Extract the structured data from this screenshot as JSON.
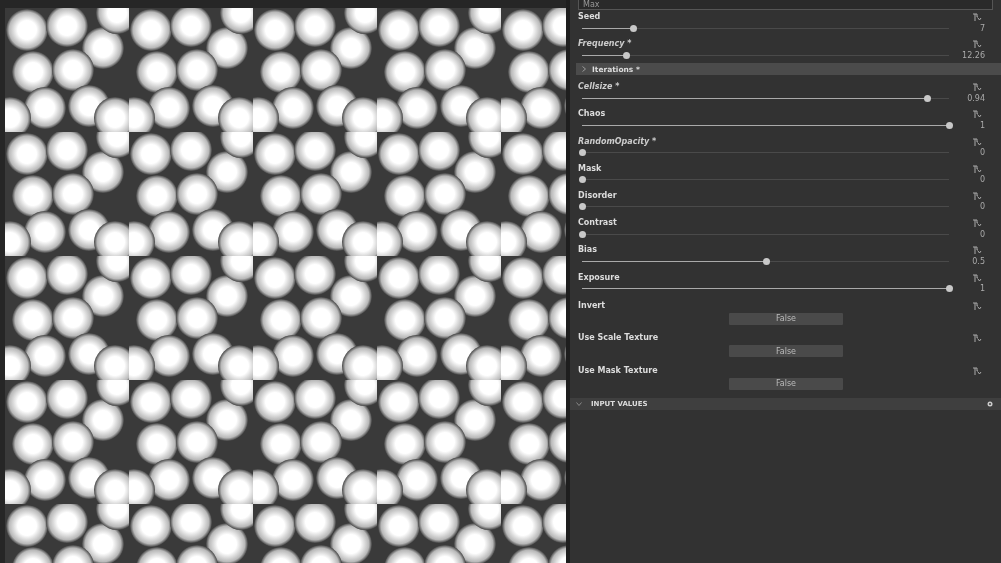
{
  "dropdown": {
    "value": "Max"
  },
  "parameters": [
    {
      "kind": "slider",
      "label": "Seed",
      "modified": false,
      "level": 0.14,
      "value": "7"
    },
    {
      "kind": "slider",
      "label": "Frequency *",
      "modified": true,
      "level": 0.12,
      "value": "12.26"
    },
    {
      "kind": "section",
      "label": "Iterations *",
      "expanded": false
    },
    {
      "kind": "slider",
      "label": "Cellsize *",
      "modified": true,
      "level": 0.94,
      "value": "0.94"
    },
    {
      "kind": "slider",
      "label": "Chaos",
      "modified": false,
      "level": 1,
      "value": "1"
    },
    {
      "kind": "slider",
      "label": "RandomOpacity *",
      "modified": true,
      "level": 0,
      "value": "0"
    },
    {
      "kind": "slider",
      "label": "Mask",
      "modified": false,
      "level": 0,
      "value": "0"
    },
    {
      "kind": "slider",
      "label": "Disorder",
      "modified": false,
      "level": 0,
      "value": "0"
    },
    {
      "kind": "slider",
      "label": "Contrast",
      "modified": false,
      "level": 0,
      "value": "0"
    },
    {
      "kind": "slider",
      "label": "Bias",
      "modified": false,
      "level": 0.5,
      "value": "0.5"
    },
    {
      "kind": "slider",
      "label": "Exposure",
      "modified": false,
      "level": 1,
      "value": "1"
    },
    {
      "kind": "toggle",
      "label": "Invert",
      "value": "False"
    },
    {
      "kind": "toggle",
      "label": "Use Scale Texture",
      "value": "False"
    },
    {
      "kind": "toggle",
      "label": "Use Mask Texture",
      "value": "False"
    }
  ],
  "input_values": {
    "label": "INPUT VALUES",
    "expanded": true
  }
}
